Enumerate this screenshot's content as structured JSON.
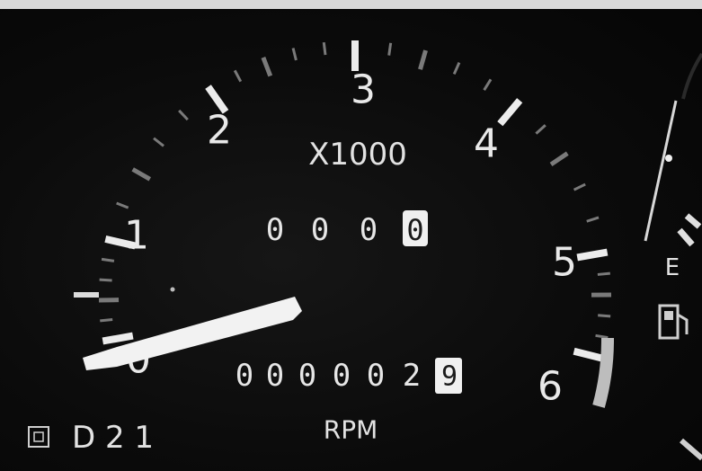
{
  "tachometer": {
    "scale_numbers": [
      "0",
      "1",
      "2",
      "3",
      "4",
      "5",
      "6"
    ],
    "multiplier_label": "X1000",
    "unit_label": "RPM",
    "needle_value_rpm_x1000": 0
  },
  "trip_odometer": {
    "digits": [
      "0",
      "0",
      "0",
      "0"
    ]
  },
  "odometer": {
    "digits": [
      "0",
      "0",
      "0",
      "0",
      "0",
      "2",
      "9"
    ]
  },
  "gear_indicator": {
    "text": "D 2 1"
  },
  "fuel_gauge": {
    "empty_label": "E"
  },
  "colors": {
    "background": "#0a0a0a",
    "markings": "#e9e9e9",
    "needle": "#f2f2f2"
  },
  "icons": [
    "fuel-pump-icon",
    "lock-icon",
    "gear-indicator-icon"
  ]
}
